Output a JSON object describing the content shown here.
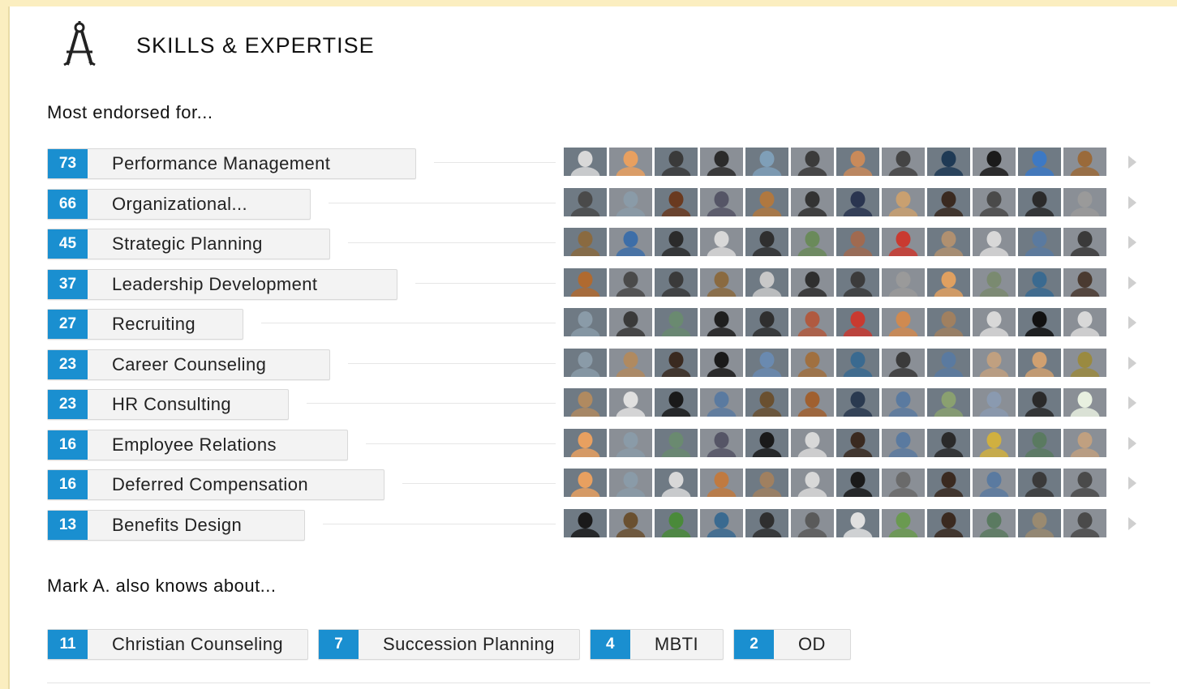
{
  "section": {
    "title": "SKILLS & EXPERTISE",
    "icon": "compass-icon"
  },
  "most_endorsed_heading": "Most endorsed for...",
  "skills": [
    {
      "count": "73",
      "name": "Performance Management",
      "pill_width": 453
    },
    {
      "count": "66",
      "name": "Organizational...",
      "pill_width": 323
    },
    {
      "count": "45",
      "name": "Strategic Planning",
      "pill_width": 347
    },
    {
      "count": "37",
      "name": "Leadership Development",
      "pill_width": 430
    },
    {
      "count": "27",
      "name": "Recruiting",
      "pill_width": 240
    },
    {
      "count": "23",
      "name": "Career Counseling",
      "pill_width": 347
    },
    {
      "count": "23",
      "name": "HR Consulting",
      "pill_width": 296
    },
    {
      "count": "16",
      "name": "Employee Relations",
      "pill_width": 369
    },
    {
      "count": "16",
      "name": "Deferred Compensation",
      "pill_width": 414
    },
    {
      "count": "13",
      "name": "Benefits Design",
      "pill_width": 316
    }
  ],
  "also_knows_heading": "Mark A. also knows about...",
  "also_knows": [
    {
      "count": "11",
      "name": "Christian Counseling"
    },
    {
      "count": "7",
      "name": "Succession Planning"
    },
    {
      "count": "4",
      "name": "MBTI"
    },
    {
      "count": "2",
      "name": "OD"
    }
  ],
  "colors": {
    "count_badge": "#1a8fd0",
    "page_background": "#fbeec0",
    "pill_background": "#f3f3f3"
  },
  "avatar_palette": [
    [
      "#d8d8d8",
      "#e8a060",
      "#3a3a3a",
      "#2b2b2b",
      "#7f9fb8",
      "#3b3b3b",
      "#c98a5a",
      "#444",
      "#1f3a55",
      "#1b1b1b",
      "#3d79c4",
      "#9a6a3a"
    ],
    [
      "#4a4a4a",
      "#8a9ba8",
      "#6a3a20",
      "#556",
      "#b07840",
      "#333",
      "#2a3550",
      "#c9a070",
      "#3a2a20",
      "#4a4a4a",
      "#2a2a2a",
      "#9a9a9a"
    ],
    [
      "#8a6a40",
      "#3d6ea8",
      "#2b2b2b",
      "#d8d8d8",
      "#2f2f2f",
      "#6a8a5a",
      "#a06a50",
      "#c93a30",
      "#b09070",
      "#d8d8d8",
      "#5a7aa0",
      "#3a3a3a"
    ],
    [
      "#b06a30",
      "#4a4a4a",
      "#3a3a3a",
      "#8a6a40",
      "#c8c8c8",
      "#2f2f2f",
      "#3b3b3b",
      "#9a9a9a",
      "#e0a060",
      "#7a8a70",
      "#3a6a90",
      "#4a3a30"
    ],
    [
      "#8a9ba8",
      "#3a3a3a",
      "#6a8a70",
      "#1f1f1f",
      "#2f2f2f",
      "#b05a40",
      "#c93a30",
      "#d08a50",
      "#a08060",
      "#d8d8d8",
      "#111",
      "#d8d8d8"
    ],
    [
      "#8a9ba8",
      "#b08a60",
      "#3a2a20",
      "#1a1a1a",
      "#6a8ab0",
      "#a07040",
      "#3a6a90",
      "#3a3a3a",
      "#5a7aa0",
      "#c0a080",
      "#d0a070",
      "#9a8a40"
    ],
    [
      "#b08a60",
      "#e0e0e0",
      "#1a1a1a",
      "#5a7aa0",
      "#6a5030",
      "#a06030",
      "#2a3a50",
      "#5a7aa0",
      "#8aa070",
      "#8a9ab0",
      "#2a2a2a",
      "#e8f0e0"
    ],
    [
      "#e8a060",
      "#8a9ba8",
      "#6a8a70",
      "#556",
      "#1a1a1a",
      "#d8d8d8",
      "#3a2a20",
      "#5a7aa0",
      "#2a2a2a",
      "#d0b040",
      "#5a7a60",
      "#c0a080"
    ],
    [
      "#e8a060",
      "#8a9ba8",
      "#d8d8d8",
      "#c07a40",
      "#a08060",
      "#d8d8d8",
      "#1a1a1a",
      "#6a6a6a",
      "#3a2a20",
      "#5a7aa0",
      "#3a3a3a",
      "#4a4a4a"
    ],
    [
      "#1a1a1a",
      "#6a5030",
      "#4a8a3a",
      "#3a6a90",
      "#2f2f2f",
      "#5a5a5a",
      "#e0e0e0",
      "#6a9a50",
      "#3a2a20",
      "#5a7a60",
      "#9a8a70",
      "#4a4a4a"
    ]
  ]
}
